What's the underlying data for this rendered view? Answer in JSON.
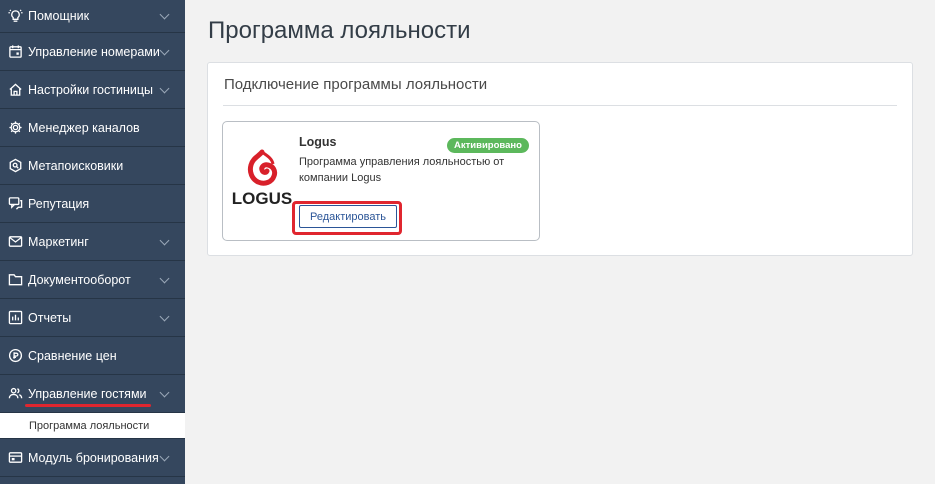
{
  "sidebar": {
    "items": [
      {
        "label": "Помощник",
        "icon": "lightbulb-icon",
        "has_chevron": true
      },
      {
        "label": "Управление номерами",
        "icon": "calendar-icon",
        "has_chevron": true
      },
      {
        "label": "Настройки гостиницы",
        "icon": "home-icon",
        "has_chevron": true
      },
      {
        "label": "Менеджер каналов",
        "icon": "gear-icon",
        "has_chevron": false
      },
      {
        "label": "Метапоисковики",
        "icon": "hexagon-icon",
        "has_chevron": false
      },
      {
        "label": "Репутация",
        "icon": "chat-icon",
        "has_chevron": false
      },
      {
        "label": "Маркетинг",
        "icon": "mail-icon",
        "has_chevron": true
      },
      {
        "label": "Документооборот",
        "icon": "folder-icon",
        "has_chevron": true
      },
      {
        "label": "Отчеты",
        "icon": "bar-chart-icon",
        "has_chevron": true
      },
      {
        "label": "Сравнение цен",
        "icon": "price-compare-icon",
        "has_chevron": false
      },
      {
        "label": "Управление гостями",
        "icon": "users-icon",
        "has_chevron": true,
        "active": true
      },
      {
        "label": "Модуль бронирования",
        "icon": "booking-icon",
        "has_chevron": true
      }
    ],
    "subitem": "Программа лояльности"
  },
  "main": {
    "page_title": "Программа лояльности",
    "panel_title": "Подключение программы лояльности",
    "card": {
      "logo_text": "LOGUS",
      "name": "Logus",
      "badge": "Активировано",
      "description": "Программа управления лояльностью от компании Logus",
      "edit_label": "Редактировать"
    }
  },
  "colors": {
    "sidebar_bg": "#35475e",
    "badge_green": "#5cb85c",
    "highlight_red": "#e0262f",
    "button_blue": "#2b5597",
    "logo_red": "#d8202a"
  }
}
